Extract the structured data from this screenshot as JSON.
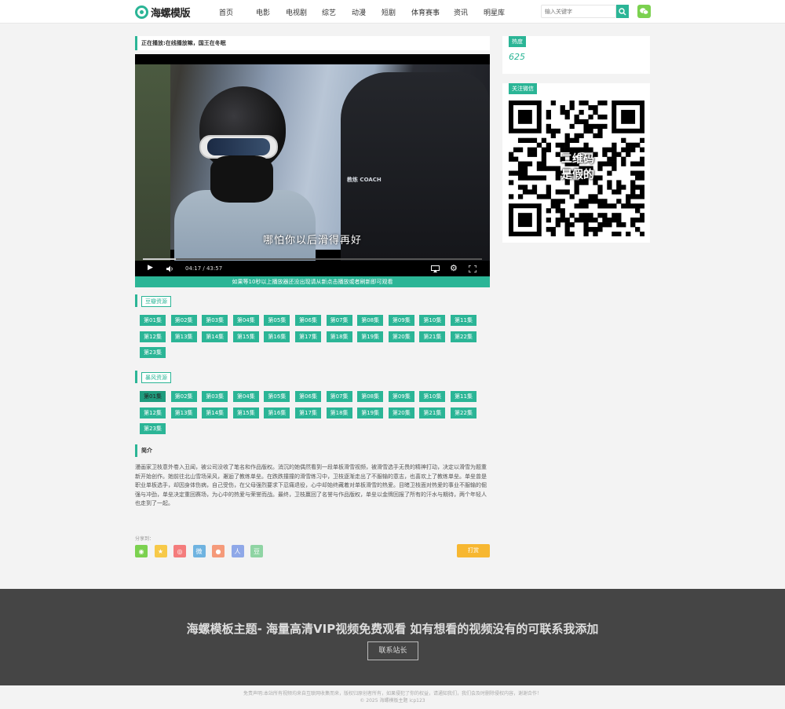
{
  "header": {
    "logo_text": "海螺模版",
    "nav": [
      "首页",
      "电影",
      "电视剧",
      "综艺",
      "动漫",
      "短剧",
      "体育赛事",
      "资讯",
      "明星库"
    ],
    "search_placeholder": "输入关键字",
    "accent_color": "#2bb596"
  },
  "player": {
    "now_playing": "正在播放:在线播放嘛，国王在冬眠",
    "subtitle": "哪怕你以后滑得再好",
    "coach_label": "教练 COACH",
    "time": "04:17 / 43:57",
    "progress": 0.098,
    "notice": "如果等10秒以上播放器还没出现请从新点击播放或者刷新即可观看"
  },
  "sources": [
    {
      "name": "豆瓣资源",
      "episodes": [
        "第01集",
        "第02集",
        "第03集",
        "第04集",
        "第05集",
        "第06集",
        "第07集",
        "第08集",
        "第09集",
        "第10集",
        "第11集",
        "第12集",
        "第13集",
        "第14集",
        "第15集",
        "第16集",
        "第17集",
        "第18集",
        "第19集",
        "第20集",
        "第21集",
        "第22集",
        "第23集"
      ]
    },
    {
      "name": "暴风资源",
      "episodes": [
        "第01集",
        "第02集",
        "第03集",
        "第04集",
        "第05集",
        "第06集",
        "第07集",
        "第08集",
        "第09集",
        "第10集",
        "第11集",
        "第12集",
        "第13集",
        "第14集",
        "第15集",
        "第16集",
        "第17集",
        "第18集",
        "第19集",
        "第20集",
        "第21集",
        "第22集",
        "第23集"
      ],
      "active_index": 0
    }
  ],
  "intro": {
    "heading": "简介",
    "text": "漫画家卫枝意外卷入丑闻，被公司没收了笔名和作品版权。消沉的她偶然看到一段单板滑雪视频，被滑雪选手无畏的精神打动，决定以滑雪为题重新开始创作。她前往北山雪场采风，邂逅了教练单垒。在跌跌撞撞的滑雪练习中，卫枝逐渐走出了不服输的意志，也喜欢上了教练单垒。单垒曾是职业单板选手，却因身体伤病，自己受伤，在父母强烈要求下忍痛退役，心中却始终藏着对单板滑雪的热爱。目睹卫枝面对热爱的事业不服输的倔强与冲劲，单垒决定重回赛场，为心中的热爱与荣誉而战。最终，卫枝赢回了名誉与作品版权，单垒以金牌回报了所有的汗水与期待，两个年轻人也走到了一起。"
  },
  "share": {
    "label": "分享到：",
    "icons": [
      {
        "name": "wechat-share-icon",
        "color": "#7bd14f",
        "glyph": "◉"
      },
      {
        "name": "qzone-share-icon",
        "color": "#f7c948",
        "glyph": "★"
      },
      {
        "name": "weibo-share-icon",
        "color": "#f47c7c",
        "glyph": "◎"
      },
      {
        "name": "tencent-weibo-share-icon",
        "color": "#6fb3e0",
        "glyph": "微"
      },
      {
        "name": "qq-share-icon",
        "color": "#f59a7a",
        "glyph": "●"
      },
      {
        "name": "renren-share-icon",
        "color": "#8fa8e8",
        "glyph": "人"
      },
      {
        "name": "douban-share-icon",
        "color": "#8fd4a3",
        "glyph": "豆"
      }
    ],
    "tip_label": "打赏"
  },
  "sidebar": {
    "heat_label": "热度",
    "heat_value": "625",
    "wechat_label": "关注微信",
    "qr_text_1": "二维码",
    "qr_text_2": "是假的"
  },
  "footer": {
    "title": "海螺模板主题- 海量高清VIP视频免费观看 如有想看的视频没有的可联系我添加",
    "contact_label": "联系站长",
    "disclaimer": "免责声明:本站所有视频均来自互联网收集而来，版权归原创者所有，如果侵犯了你的权益，请通知我们，我们会及时删除侵权内容，谢谢合作！",
    "copyright": "© 2025 海螺模板主题  icp123"
  }
}
